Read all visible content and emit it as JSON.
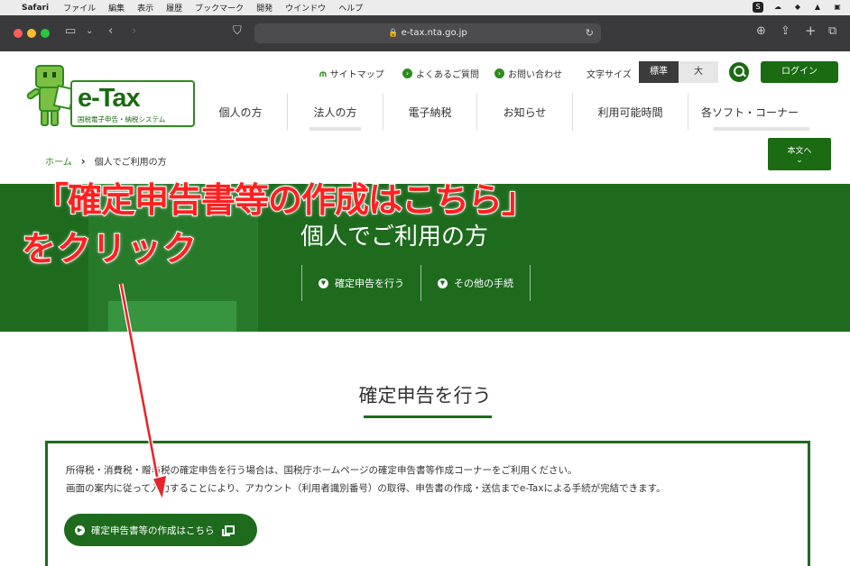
{
  "menubar": {
    "app": "Safari",
    "items": [
      "ファイル",
      "編集",
      "表示",
      "履歴",
      "ブックマーク",
      "開発",
      "ウインドウ",
      "ヘルプ"
    ]
  },
  "browser": {
    "url": "e-tax.nta.go.jp"
  },
  "logo": {
    "brand": "e-Tax",
    "subtitle": "国税電子申告・納税システム"
  },
  "utility_nav": {
    "sitemap": "サイトマップ",
    "faq": "よくあるご質問",
    "contact": "お問い合わせ",
    "font_size_label": "文字サイズ",
    "font_standard": "標準",
    "font_large": "大",
    "login": "ログイン"
  },
  "main_nav": [
    "個人の方",
    "法人の方",
    "電子納税",
    "お知らせ",
    "利用可能時間",
    "各ソフト・コーナー"
  ],
  "breadcrumb": {
    "home": "ホーム",
    "current": "個人でご利用の方"
  },
  "to_content": {
    "label": "本文へ",
    "chevron": "⌄"
  },
  "hero": {
    "title": "個人でご利用の方",
    "tabs": [
      "確定申告を行う",
      "その他の手続"
    ]
  },
  "section": {
    "title": "確定申告を行う",
    "desc1": "所得税・消費税・贈与税の確定申告を行う場合は、国税庁ホームページの確定申告書等作成コーナーをご利用ください。",
    "desc2": "画面の案内に従って入力することにより、アカウント（利用者識別番号）の取得、申告書の作成・送信までe-Taxによる手続が完結できます。",
    "button": "確定申告書等の作成はこちら"
  },
  "callout": {
    "line1": "「確定申告書等の作成はこちら」",
    "line2": "をクリック"
  },
  "colors": {
    "brand_green": "#1a6b12",
    "hero_green": "#1e6b1e",
    "callout_red": "#ff2020"
  }
}
